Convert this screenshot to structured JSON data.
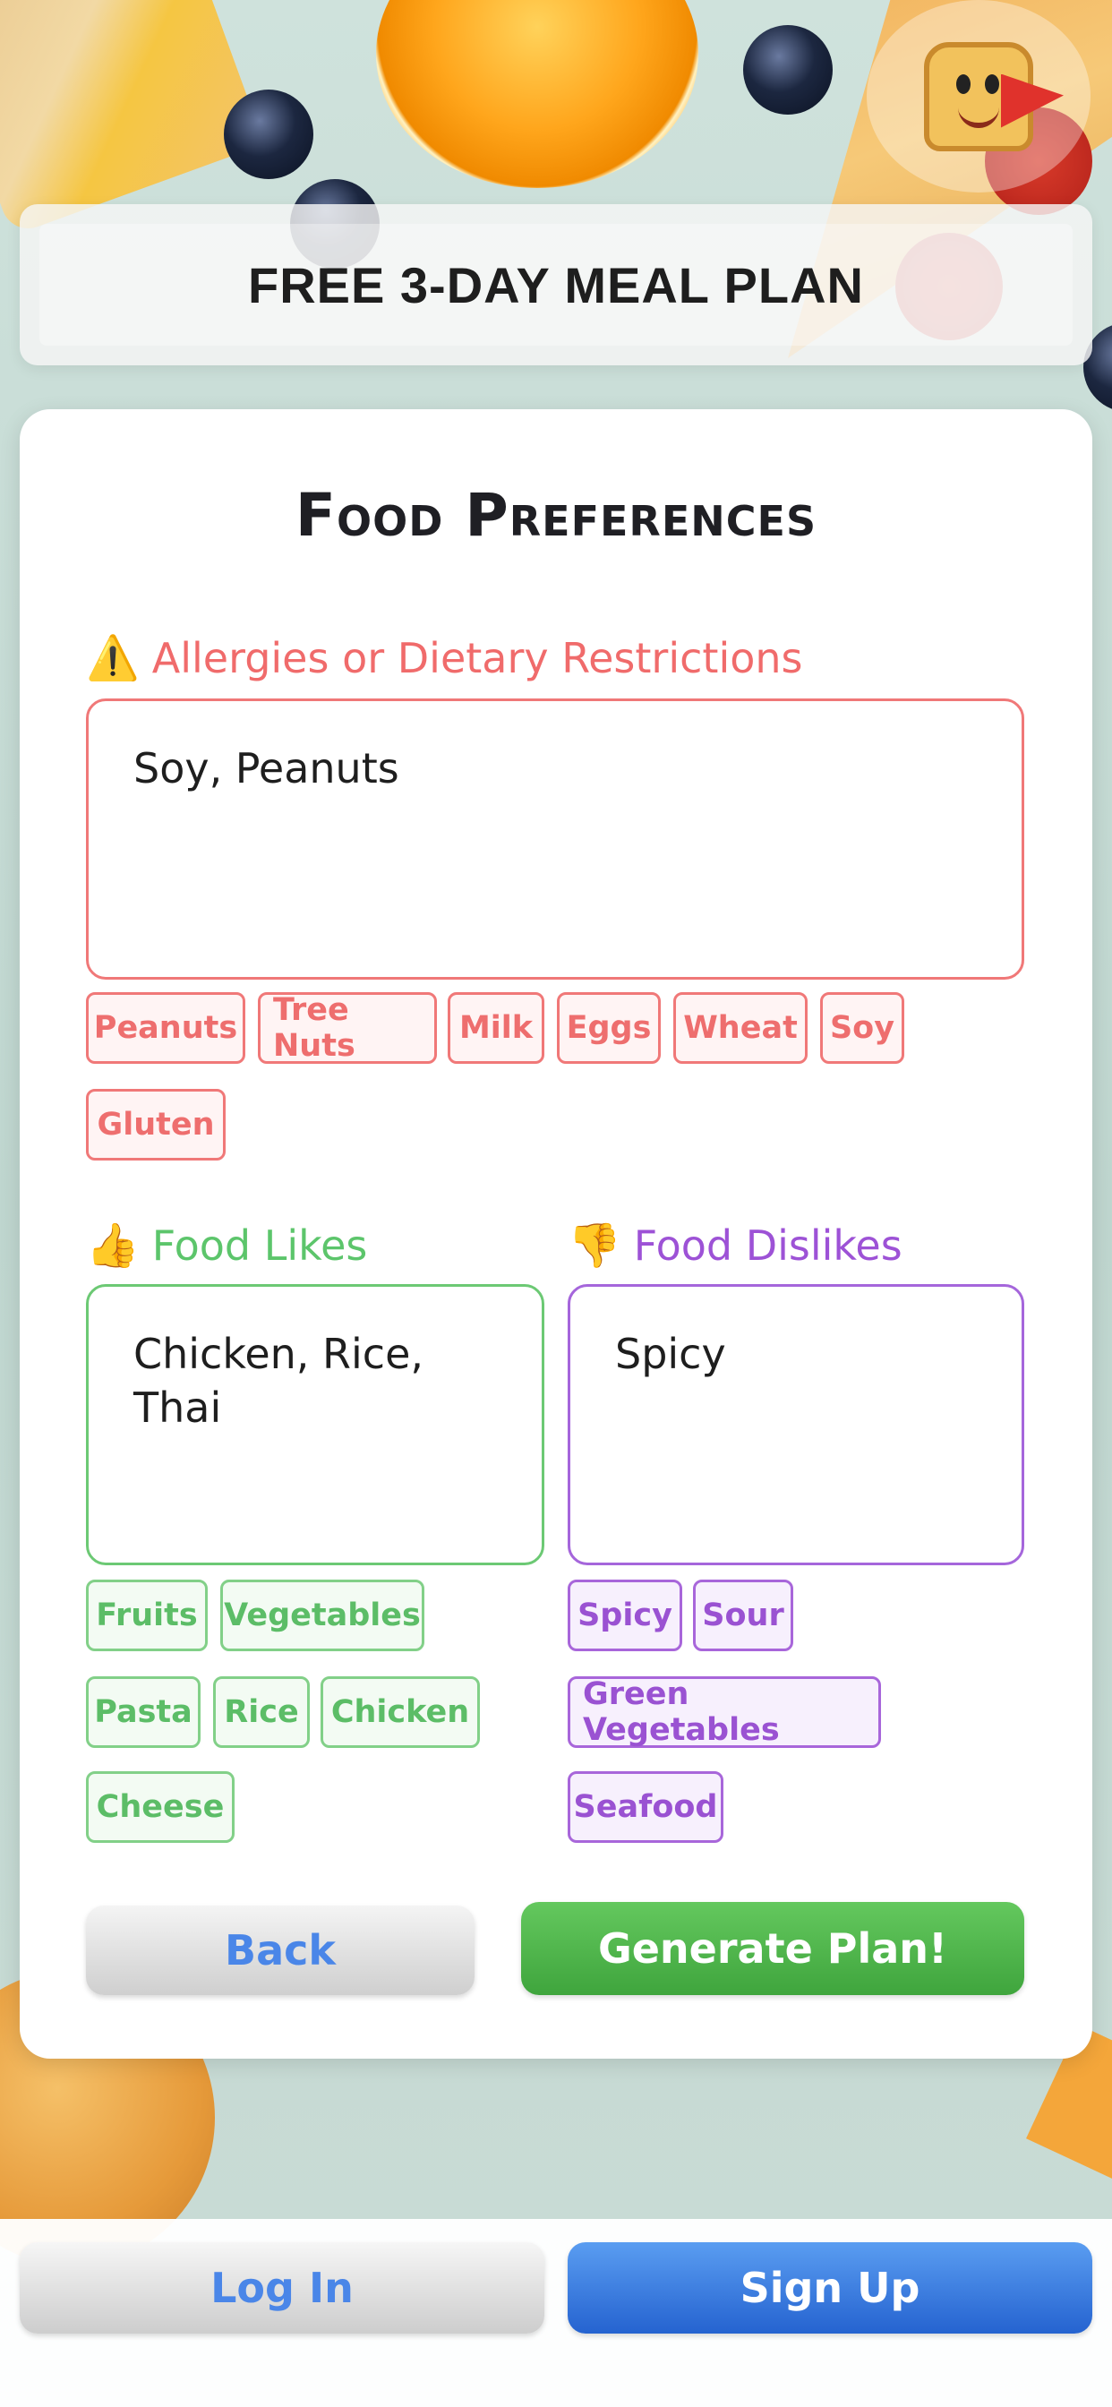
{
  "header": {
    "title": "FREE 3-DAY MEAL PLAN",
    "mascot_icon": "toast-superhero-icon"
  },
  "card": {
    "title": "Food Preferences"
  },
  "allergies": {
    "icon": "warning-icon",
    "icon_glyph": "⚠️",
    "label": "Allergies or Dietary Restrictions",
    "value": "Soy, Peanuts",
    "chips": [
      "Peanuts",
      "Tree Nuts",
      "Milk",
      "Eggs",
      "Wheat",
      "Soy",
      "Gluten"
    ]
  },
  "likes": {
    "icon": "thumbs-up-icon",
    "icon_glyph": "👍",
    "label": "Food Likes",
    "value": "Chicken, Rice,\nThai",
    "chips": [
      "Fruits",
      "Vegetables",
      "Pasta",
      "Rice",
      "Chicken",
      "Cheese"
    ]
  },
  "dislikes": {
    "icon": "thumbs-down-icon",
    "icon_glyph": "👎",
    "label": "Food Dislikes",
    "value": "Spicy",
    "chips": [
      "Spicy",
      "Sour",
      "Green Vegetables",
      "Seafood"
    ]
  },
  "actions": {
    "back_label": "Back",
    "generate_label": "Generate Plan!"
  },
  "footer": {
    "login_label": "Log In",
    "signup_label": "Sign Up"
  },
  "colors": {
    "allergy_accent": "#f06b6b",
    "likes_accent": "#5cc56b",
    "dislikes_accent": "#9d52d6",
    "primary_blue": "#4a86e8",
    "generate_green": "#4caf50"
  }
}
